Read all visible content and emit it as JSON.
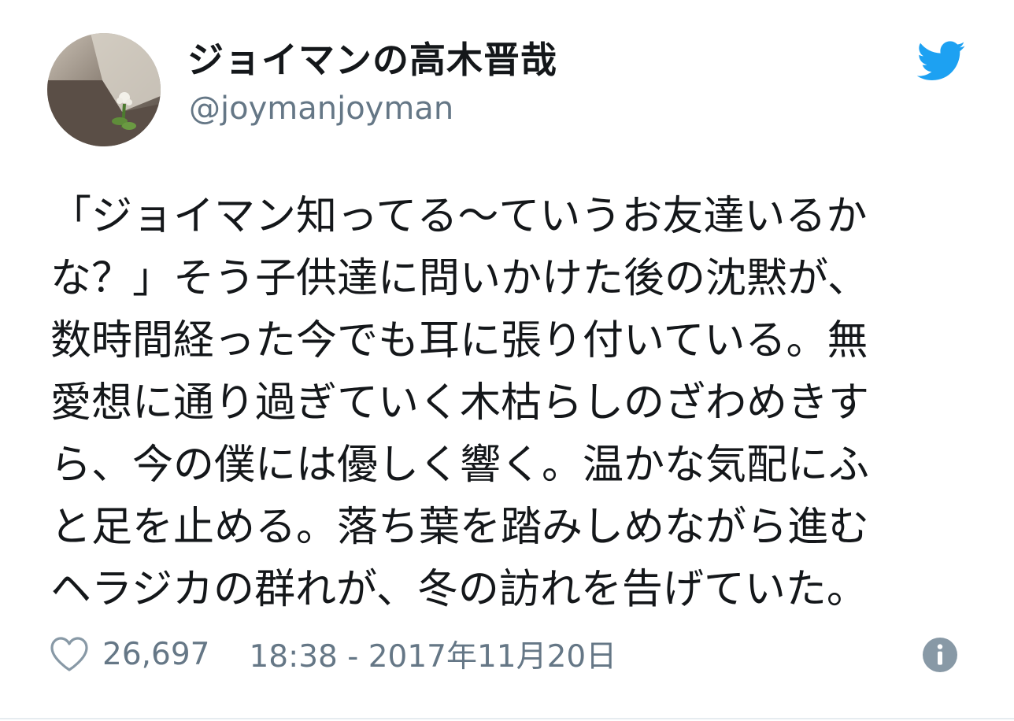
{
  "user": {
    "display_name": "ジョイマンの高木晋哉",
    "handle": "@joymanjoyman",
    "avatar_icon": "avatar-photo-icon"
  },
  "brand": {
    "logo_icon": "twitter-bird-icon",
    "accent_color": "#1da1f2"
  },
  "tweet": {
    "lines": [
      "「ジョイマン知ってる～ていうお友達いるか",
      "な？」そう子供達に問いかけた後の沈黙が、",
      "数時間経った今でも耳に張り付いている。無",
      "愛想に通り過ぎていく木枯らしのざわめきす",
      "ら、今の僕には優しく響く。温かな気配にふ",
      "と足を止める。落ち葉を踏みしめながら進む",
      "ヘラジカの群れが、冬の訪れを告げていた。"
    ]
  },
  "footer": {
    "like_icon": "heart-icon",
    "like_count": "26,697",
    "timestamp": "18:38 - 2017年11月20日",
    "info_icon": "info-icon"
  }
}
